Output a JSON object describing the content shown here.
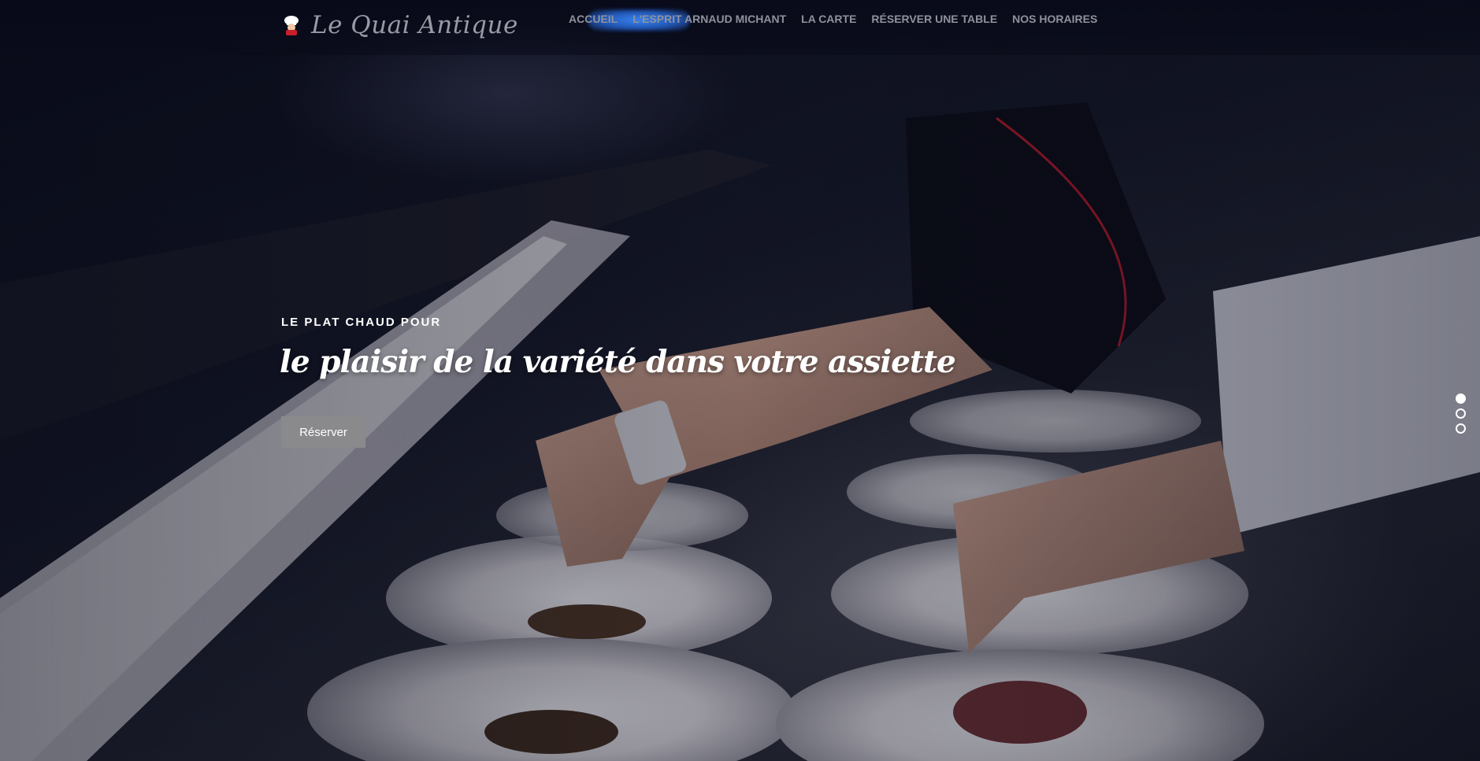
{
  "header": {
    "logo_text": "Le Quai Antique",
    "logo_icon": "chef-icon"
  },
  "nav": {
    "items": [
      {
        "label": "ACCUEIL"
      },
      {
        "label": "L'ESPRIT ARNAUD MICHANT"
      },
      {
        "label": "LA CARTE"
      },
      {
        "label": "RÉSERVER UNE TABLE"
      },
      {
        "label": "NOS HORAIRES"
      }
    ]
  },
  "hero": {
    "kicker": "LE PLAT CHAUD POUR",
    "headline": "le plaisir de la variété dans votre assiette",
    "cta_label": "Réserver"
  },
  "slider": {
    "slide_count": 3,
    "active_index": 0
  },
  "colors": {
    "nav_text": "#8f929c",
    "cta_bg": "#8a8a8c",
    "glow": "#3c8cff"
  }
}
